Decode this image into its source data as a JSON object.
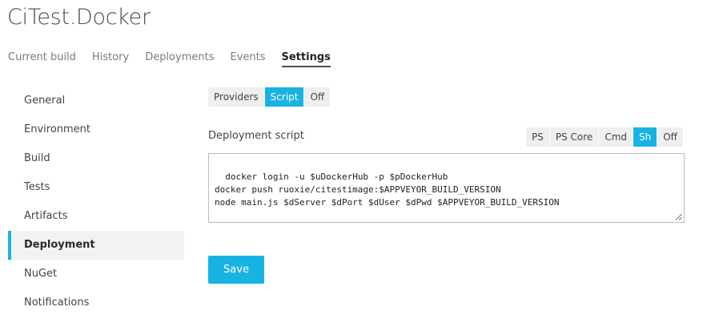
{
  "project": {
    "title": "CiTest.Docker"
  },
  "top_tabs": [
    {
      "label": "Current build"
    },
    {
      "label": "History"
    },
    {
      "label": "Deployments"
    },
    {
      "label": "Events"
    },
    {
      "label": "Settings",
      "active": true
    }
  ],
  "sidebar": {
    "items": [
      {
        "label": "General"
      },
      {
        "label": "Environment"
      },
      {
        "label": "Build"
      },
      {
        "label": "Tests"
      },
      {
        "label": "Artifacts"
      },
      {
        "label": "Deployment",
        "active": true
      },
      {
        "label": "NuGet"
      },
      {
        "label": "Notifications"
      }
    ]
  },
  "deployment_mode": {
    "options": [
      {
        "label": "Providers"
      },
      {
        "label": "Script",
        "active": true
      },
      {
        "label": "Off"
      }
    ]
  },
  "script": {
    "label": "Deployment script",
    "languages": [
      {
        "label": "PS"
      },
      {
        "label": "PS Core"
      },
      {
        "label": "Cmd"
      },
      {
        "label": "Sh",
        "active": true
      },
      {
        "label": "Off"
      }
    ],
    "content": "docker login -u $uDockerHub -p $pDockerHub\ndocker push ruoxie/citestimage:$APPVEYOR_BUILD_VERSION\nnode main.js $dServer $dPort $dUser $dPwd $APPVEYOR_BUILD_VERSION"
  },
  "actions": {
    "save_label": "Save"
  },
  "colors": {
    "accent": "#19b3e3",
    "segment_bg": "#efefef",
    "active_sidebar_bg": "#f2f2f2"
  }
}
